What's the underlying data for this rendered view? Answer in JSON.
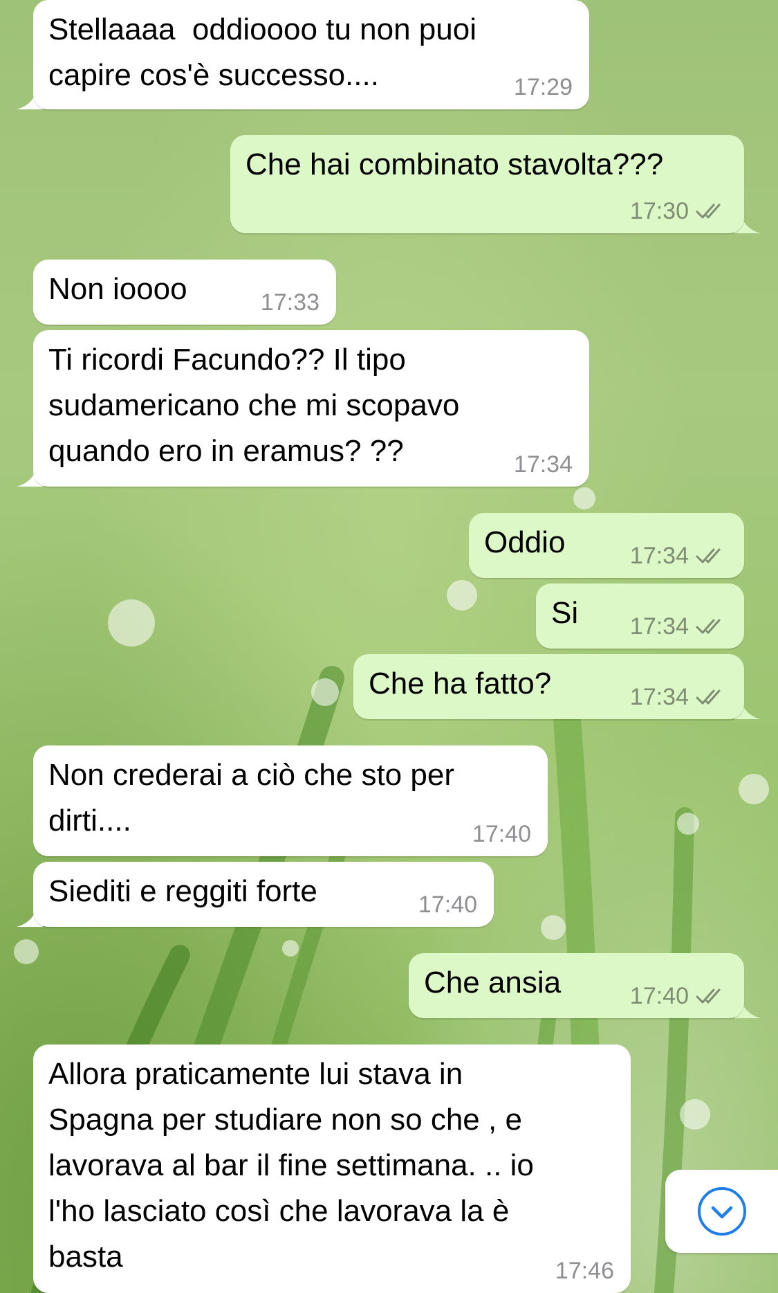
{
  "chat": {
    "messages": [
      {
        "direction": "in",
        "text": "Stellaaaa  oddioooo tu non puoi\ncapire cos'è successo....",
        "time": "17:29",
        "tail": true
      },
      {
        "direction": "out",
        "text": "Che hai combinato stavolta???",
        "time": "17:30",
        "tail": true
      },
      {
        "direction": "in",
        "text": "Non ioooo",
        "time": "17:33",
        "tail": false
      },
      {
        "direction": "in",
        "text": "Ti ricordi Facundo?? Il tipo\nsudamericano che mi scopavo\nquando ero in eramus? ??",
        "time": "17:34",
        "tail": true
      },
      {
        "direction": "out",
        "text": "Oddio",
        "time": "17:34",
        "tail": false
      },
      {
        "direction": "out",
        "text": "Si",
        "time": "17:34",
        "tail": false
      },
      {
        "direction": "out",
        "text": "Che ha fatto?",
        "time": "17:34",
        "tail": true
      },
      {
        "direction": "in",
        "text": "Non crederai a ciò che sto per\ndirti....",
        "time": "17:40",
        "tail": false
      },
      {
        "direction": "in",
        "text": "Siediti e reggiti forte",
        "time": "17:40",
        "tail": true
      },
      {
        "direction": "out",
        "text": "Che ansia",
        "time": "17:40",
        "tail": true
      },
      {
        "direction": "in",
        "text": "Allora praticamente lui stava in\nSpagna per studiare non so che , e\nlavorava al bar il fine settimana. .. io\nl'ho lasciato così che lavorava la è\nbasta",
        "time": "17:46",
        "tail": false
      }
    ]
  },
  "icons": {
    "read_receipt": "double-check-icon",
    "scroll_down": "chevron-down-circle-icon"
  },
  "colors": {
    "incoming_bubble": "#ffffff",
    "outgoing_bubble": "#dcf8c6",
    "timestamp": "#8e8e93",
    "scroll_button_accent": "#1f7ee8"
  }
}
